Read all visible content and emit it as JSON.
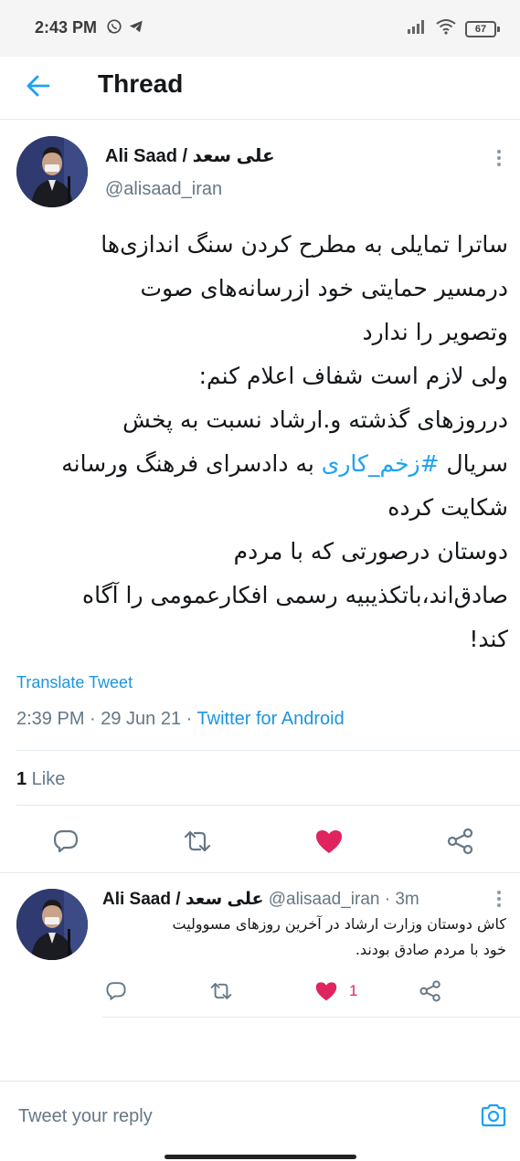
{
  "status_bar": {
    "time": "2:43 PM",
    "battery": "67"
  },
  "header": {
    "title": "Thread"
  },
  "main_tweet": {
    "author_name": "Ali Saad / علی سعد",
    "author_handle": "@alisaad_iran",
    "lines": [
      "ساترا تمایلی به مطرح کردن سنگ اندازی‌ها",
      "درمسیر حمایتی خود ازرسانه‌های صوت",
      "وتصویر را ندارد",
      "ولی لازم است شفاف اعلام کنم:",
      "درروزهای گذشته و.ارشاد نسبت به پخش"
    ],
    "hashtag_line_prefix": "سریال ",
    "hashtag": "#زخم_کاری",
    "hashtag_line_suffix": " به دادسرای فرهنگ ورسانه",
    "lines_after": [
      "شکایت کرده",
      "دوستان درصورتی که با مردم",
      "صادق‌اند،باتکذیبیه رسمی افکارعمومی را آگاه",
      "کند!"
    ],
    "translate_label": "Translate Tweet",
    "timestamp": "2:39 PM · 29 Jun 21 · ",
    "source_app": "Twitter for Android",
    "like_count": "1",
    "like_label": " Like"
  },
  "reply_tweet": {
    "author_name": "Ali Saad / علی سعد",
    "handle_time": " @alisaad_iran · 3m",
    "lines": [
      "کاش دوستان وزارت ارشاد در آخرین روزهای مسوولیت",
      "خود با مردم صادق بودند."
    ],
    "like_count": "1"
  },
  "compose": {
    "placeholder": "Tweet your reply"
  },
  "colors": {
    "accent": "#1da1f2",
    "like": "#e0245e",
    "muted": "#657786",
    "icon": "#657786"
  }
}
